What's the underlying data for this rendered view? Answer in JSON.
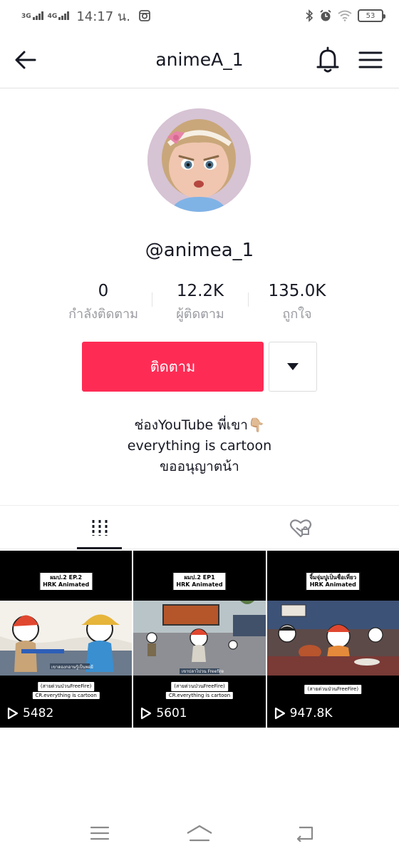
{
  "status_bar": {
    "net1": "3G",
    "net2": "4G",
    "time": "14:17 น.",
    "battery": "53"
  },
  "header": {
    "title": "animeA_1"
  },
  "profile": {
    "handle": "@animea_1",
    "stats": [
      {
        "value": "0",
        "label": "กำลังติดตาม"
      },
      {
        "value": "12.2K",
        "label": "ผู้ติดตาม"
      },
      {
        "value": "135.0K",
        "label": "ถูกใจ"
      }
    ],
    "follow_label": "ติดตาม",
    "bio_lines": [
      "ช่องYouTube พี่เขา👇🏼",
      "everything is cartoon",
      "ขออนุญาตน้า"
    ]
  },
  "tabs": [
    {
      "icon": "videos-grid-icon",
      "active": true
    },
    {
      "icon": "liked-heart-icon",
      "active": false
    }
  ],
  "videos": [
    {
      "caption": [
        "ผมป.2 EP.2",
        "HRK Animated"
      ],
      "subs": [
        "(สายต่วนป่วนFreeFire)",
        "CR.everything is cartoon"
      ],
      "scene_text": "เขาดองกอาษรู้เป็นพอยี",
      "views": "5482"
    },
    {
      "caption": [
        "ผมป.2 EP1",
        "HRK Animated"
      ],
      "subs": [
        "(สายต่วนป่วนFreeFire)",
        "CR.everything is cartoon"
      ],
      "scene_text": "เขาปลาไปวน Freefire",
      "views": "5601"
    },
    {
      "caption": [
        "จิ้มจุ่มปูเป็นชื่อเที่ยว",
        "HRK Animated"
      ],
      "subs": [
        "(สายต่วนป่วนFreeFire)"
      ],
      "scene_text": "",
      "views": "947.8K"
    }
  ],
  "colors": {
    "accent": "#fe2c55",
    "text": "#161823",
    "muted": "#9a9ba0"
  }
}
